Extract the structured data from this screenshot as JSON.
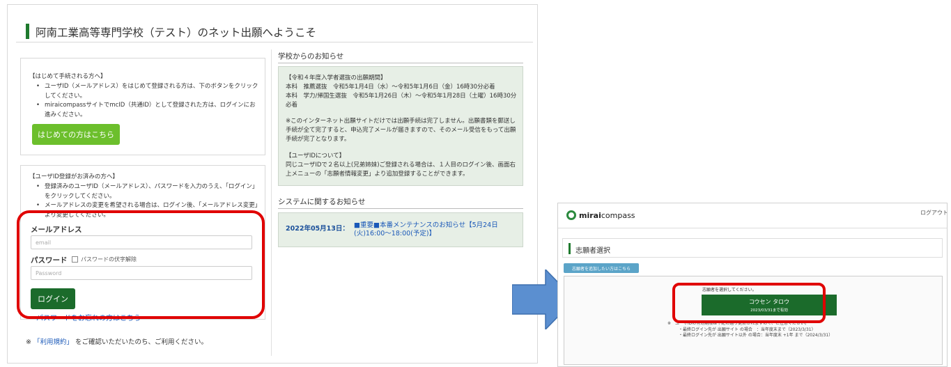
{
  "left": {
    "page_title": "阿南工業高等専門学校（テスト）のネット出願へようこそ",
    "first_time": {
      "heading": "【はじめて手続される方へ】",
      "items": [
        "ユーザID（メールアドレス）をはじめて登録される方は、下のボタンをクリックしてください。",
        "miraicompassサイトでmcID（共通ID）として登録された方は、ログインにお進みください。"
      ],
      "button": "はじめての方はこちら"
    },
    "login": {
      "heading": "【ユーザID登録がお済みの方へ】",
      "items": [
        "登録済みのユーザID（メールアドレス）、パスワードを入力のうえ、「ログイン」をクリックしてください。",
        "メールアドレスの変更を希望される場合は、ログイン後、「メールアドレス変更」より変更してください。"
      ],
      "email_label": "メールアドレス",
      "email_placeholder": "email",
      "password_label": "パスワード",
      "show_password_label": "パスワードの伏字解除",
      "password_placeholder": "Password",
      "login_button": "ログイン",
      "forgot_link": "パスワードをお忘れの方はこちら"
    },
    "terms": {
      "prefix": "※",
      "link": "「利用規約」",
      "suffix": "をご確認いただいたのち、ご利用ください。"
    },
    "school_notice": {
      "title": "学校からのお知らせ",
      "para1": "【令和４年度入学者選抜の出願期間】\n本科　推薦選抜　令和5年1月4日（水）～令和5年1月6日（金）16時30分必着\n本科　学力/帰国生選抜　令和5年1月26日（木）～令和5年1月28日（土曜）16時30分必着",
      "para2": "※このインターネット出願サイトだけでは出願手続は完了しません。出願書類を郵送し手続が全て完了すると、申込完了メールが届きますので、そのメール受信をもって出願手続が完了となります。",
      "para3": "【ユーザIDについて】\n同じユーザIDで２名以上(兄弟姉妹)ご登録される場合は、１人目のログイン後、画面右上メニューの「志願者情報変更」より追加登録することができます。"
    },
    "system_notice": {
      "title": "システムに関するお知らせ",
      "date": "2022年05月13日：",
      "message": "■重要■本番メンテナンスのお知らせ【5月24日(火)16:00～18:00(予定)】"
    }
  },
  "right": {
    "brand_bold": "mirai",
    "brand_rest": "compass",
    "logout": "ログアウト",
    "page_title": "志願者選択",
    "add_button": "志願者を追加したい方はこちら",
    "prompt": "志願者を選択してください。",
    "applicant_name": "コウセン タロウ",
    "applicant_validity": "2023/03/31まで有効",
    "note_lines": [
      "※　ユーザIDの有効期限は下記の通り更新されますので、ご注意ください。",
      "・最終ログイン先が 出願サイト の場合　：当年度末まで（2023/3/31）",
      "・最終ログイン先が 出願サイト以外 の場合：当年度末 +1年 まで（2024/3/31）"
    ]
  },
  "colors": {
    "green_button": "#6cbf2c",
    "dark_green": "#1b6b2b",
    "highlight_red": "#e00000",
    "arrow_blue": "#5b8fd0"
  }
}
